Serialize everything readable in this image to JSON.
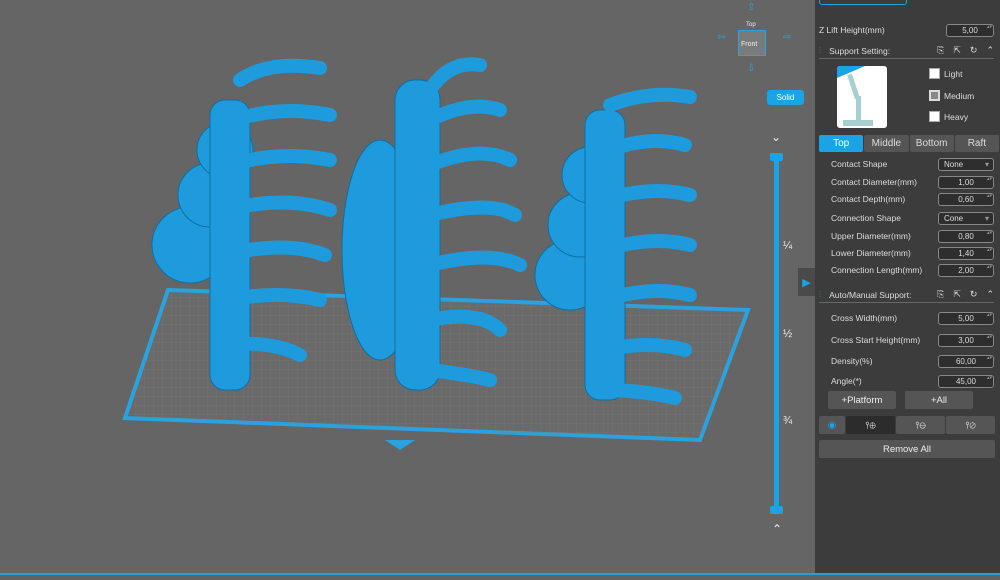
{
  "viewcube": {
    "top": "Top",
    "front": "Front"
  },
  "render_mode": "Solid",
  "slider": {
    "labels": [
      "¼",
      "½",
      "¾"
    ],
    "top_arrow": "⌄",
    "bottom_arrow": "⌃"
  },
  "panel": {
    "z_lift_label": "Z Lift Height(mm)",
    "z_lift_value": "5,00",
    "support_setting_label": "Support Setting:",
    "density_options": [
      {
        "label": "Light",
        "checked": false
      },
      {
        "label": "Medium",
        "checked": true
      },
      {
        "label": "Heavy",
        "checked": false
      }
    ],
    "tabs": [
      "Top",
      "Middle",
      "Bottom",
      "Raft"
    ],
    "active_tab": "Top",
    "fields": [
      {
        "label": "Contact Shape",
        "value": "None",
        "type": "select"
      },
      {
        "label": "Contact Diameter(mm)",
        "value": "1,00",
        "type": "spin"
      },
      {
        "label": "Contact Depth(mm)",
        "value": "0,60",
        "type": "spin"
      },
      {
        "label": "Connection Shape",
        "value": "Cone",
        "type": "select"
      },
      {
        "label": "Upper Diameter(mm)",
        "value": "0,80",
        "type": "spin"
      },
      {
        "label": "Lower Diameter(mm)",
        "value": "1,40",
        "type": "spin"
      },
      {
        "label": "Connection Length(mm)",
        "value": "2,00",
        "type": "spin"
      }
    ],
    "auto_manual_label": "Auto/Manual Support:",
    "auto_fields": [
      {
        "label": "Cross Width(mm)",
        "value": "5,00"
      },
      {
        "label": "Cross Start Height(mm)",
        "value": "3,00"
      },
      {
        "label": "Density(%)",
        "value": "60,00"
      },
      {
        "label": "Angle(*)",
        "value": "45,00"
      }
    ],
    "platform_button": "+Platform",
    "all_button": "+All",
    "remove_all_button": "Remove All"
  },
  "colors": {
    "accent": "#1aa3e6",
    "model": "#1e9bdc"
  }
}
